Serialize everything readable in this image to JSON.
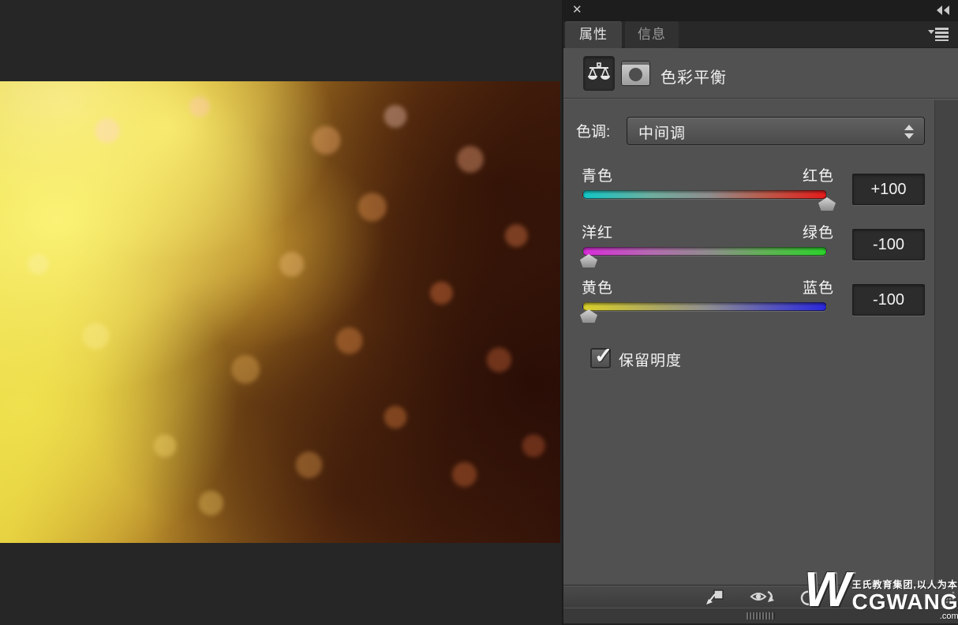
{
  "window": {
    "close_icon": "✕",
    "collapse_icon": "collapse-to-icons"
  },
  "tabs": {
    "properties": "属性",
    "info": "信息"
  },
  "header": {
    "title": "色彩平衡"
  },
  "tone": {
    "label": "色调:",
    "value": "中间调"
  },
  "sliders": {
    "cyan_red": {
      "left": "青色",
      "right": "红色",
      "value": "+100",
      "position_pct": 100
    },
    "magenta_green": {
      "left": "洋红",
      "right": "绿色",
      "value": "-100",
      "position_pct": 0
    },
    "yellow_blue": {
      "left": "黄色",
      "right": "蓝色",
      "value": "-100",
      "position_pct": 0
    }
  },
  "checkbox": {
    "label": "保留明度",
    "checked": true,
    "check_icon": "✓"
  },
  "watermark": {
    "logo": "W",
    "line1": "王氏教育集团,以人为本",
    "brand": "CGWANG",
    "tld": ".com"
  },
  "colors": {
    "panel_bg": "#515151",
    "topbar_bg": "#1d1d1d",
    "canvas_bg": "#262626",
    "cyan": "#12c6c6",
    "red": "#e51b1b",
    "magenta": "#d92cd9",
    "green": "#2bd22b",
    "yellow": "#d9d02b",
    "blue": "#2a28de"
  }
}
